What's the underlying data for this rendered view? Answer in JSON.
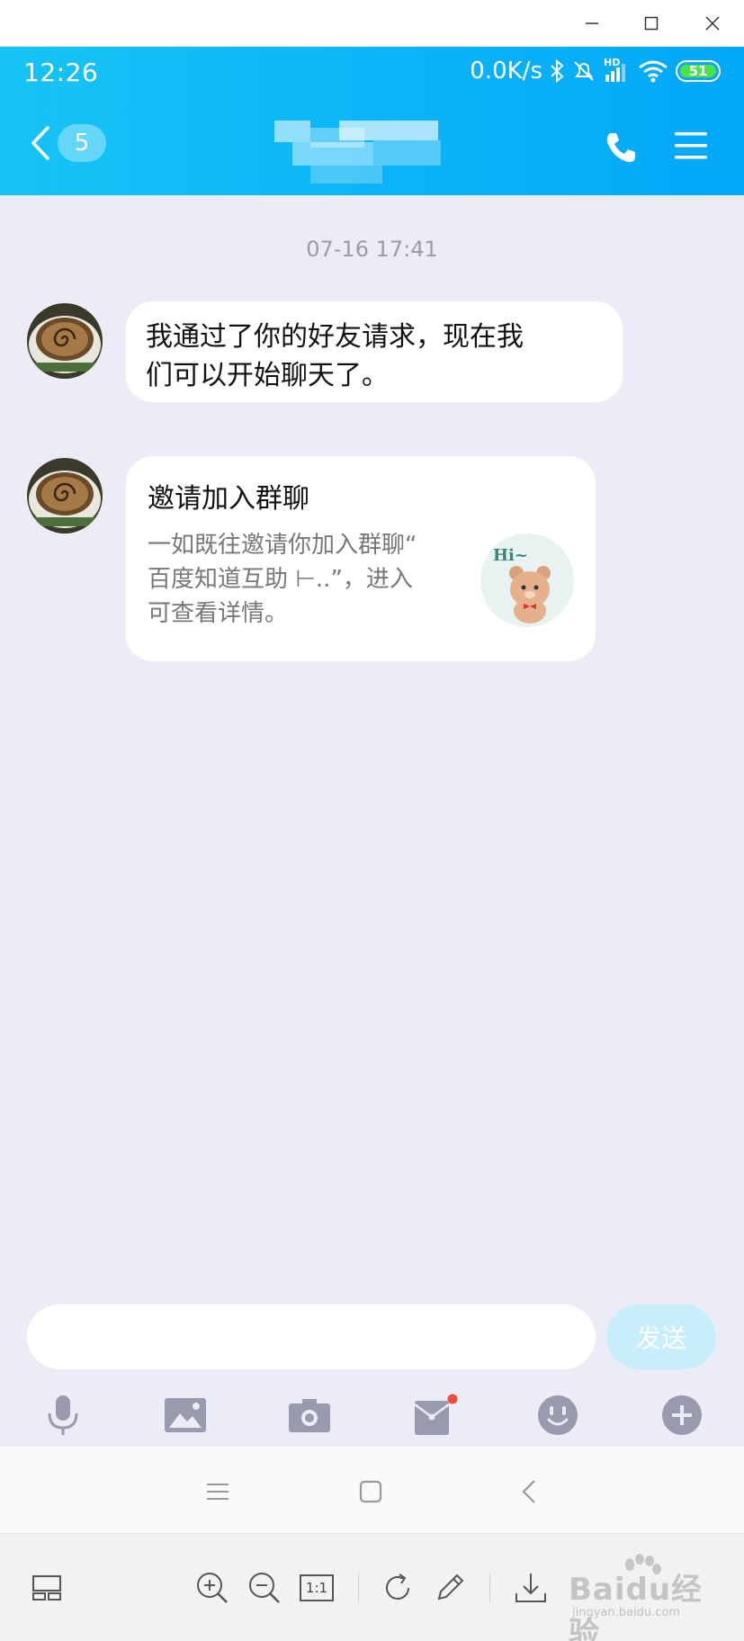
{
  "window": {
    "minimize_icon": "minimize-icon",
    "maximize_icon": "maximize-icon",
    "close_icon": "close-icon"
  },
  "status_bar": {
    "time": "12:26",
    "net_speed": "0.0K/s",
    "signal_label": "HD",
    "battery": "51",
    "icons": [
      "bluetooth-icon",
      "mute-alarm-icon",
      "signal-icon",
      "wifi-icon",
      "battery-icon"
    ]
  },
  "header": {
    "unread_count": "5",
    "title": "",
    "actions": [
      "phone-icon",
      "menu-icon"
    ]
  },
  "chat": {
    "timestamp": "07-16 17:41",
    "messages": [
      {
        "type": "text",
        "text_line1": "我通过了你的好友请求，现在我",
        "text_line2": "们可以开始聊天了。"
      },
      {
        "type": "card",
        "title": "邀请加入群聊",
        "desc_line1": "一如既往邀请你加入群聊“",
        "desc_line2": "百度知道互助 ⊢..”，进入",
        "desc_line3": "可查看详情。",
        "thumb_text": "Hi~"
      }
    ]
  },
  "input": {
    "placeholder": "",
    "send_label": "发送"
  },
  "toolbar": [
    "microphone-icon",
    "image-icon",
    "camera-icon",
    "red-packet-icon",
    "emoji-icon",
    "plus-icon"
  ],
  "viewer": {
    "zoom_actual_label": "1:1",
    "watermark": "Baidu经验",
    "watermark_sub": "jingyan.baidu.com"
  },
  "colors": {
    "header_blue": "#0db6f7",
    "chat_bg": "#ececf6",
    "send_bg": "#c8eefb",
    "badge_red": "#f24a3c"
  }
}
